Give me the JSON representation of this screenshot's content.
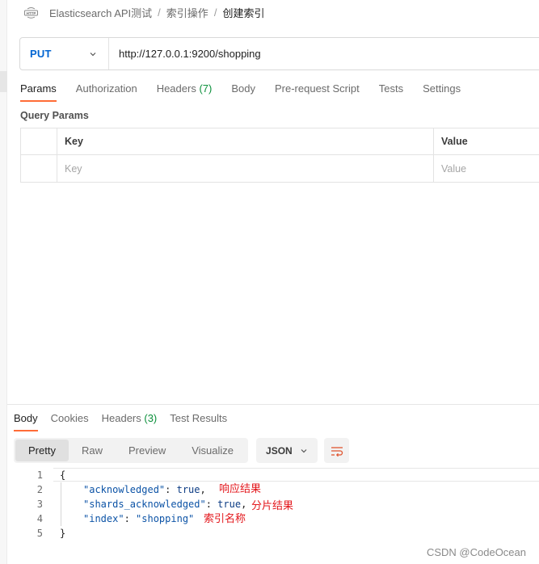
{
  "breadcrumb": {
    "collection": "Elasticsearch API测试",
    "folder": "索引操作",
    "request": "创建索引",
    "separator": "/"
  },
  "request": {
    "method": "PUT",
    "url": "http://127.0.0.1:9200/shopping"
  },
  "request_tabs": [
    {
      "label": "Params",
      "active": true
    },
    {
      "label": "Authorization"
    },
    {
      "label": "Headers",
      "count": "(7)"
    },
    {
      "label": "Body"
    },
    {
      "label": "Pre-request Script"
    },
    {
      "label": "Tests"
    },
    {
      "label": "Settings"
    }
  ],
  "query_params": {
    "title": "Query Params",
    "columns": [
      "Key",
      "Value"
    ],
    "placeholder": {
      "key": "Key",
      "value": "Value"
    }
  },
  "response_tabs": [
    {
      "label": "Body",
      "active": true
    },
    {
      "label": "Cookies"
    },
    {
      "label": "Headers",
      "count": "(3)"
    },
    {
      "label": "Test Results"
    }
  ],
  "format": {
    "modes": [
      "Pretty",
      "Raw",
      "Preview",
      "Visualize"
    ],
    "active": "Pretty",
    "language": "JSON"
  },
  "code": {
    "line_numbers": [
      "1",
      "2",
      "3",
      "4",
      "5"
    ],
    "open_brace": "{",
    "close_brace": "}",
    "entries": [
      {
        "key": "\"acknowledged\"",
        "value": "true",
        "comma": ","
      },
      {
        "key": "\"shards_acknowledged\"",
        "value": "true",
        "comma": ","
      },
      {
        "key": "\"index\"",
        "value": "\"shopping\"",
        "comma": ""
      }
    ],
    "colon": ": "
  },
  "annotations": {
    "acknowledged": "响应结果",
    "shards": "分片结果",
    "index": "索引名称"
  },
  "watermark": "CSDN @CodeOcean",
  "colors": {
    "accent": "#ff6c37",
    "method": "#0265d2",
    "count": "#0a8f3a",
    "annotation": "#e3161b"
  },
  "icons": [
    "http-icon",
    "chevron-down-icon",
    "wrap-lines-icon"
  ]
}
